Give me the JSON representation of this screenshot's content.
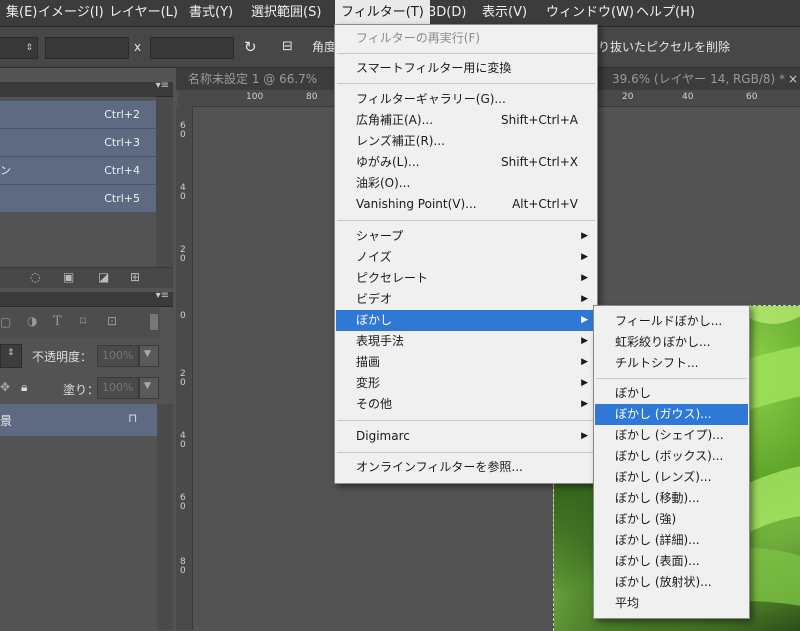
{
  "menubar": {
    "items": [
      "集(E)",
      "イメージ(I)",
      "レイヤー(L)",
      "書式(Y)",
      "選択範囲(S)",
      "フィルター(T)",
      "3D(D)",
      "表示(V)",
      "ウィンドウ(W)",
      "ヘルプ(H)"
    ]
  },
  "options": {
    "x_label": "x",
    "angle_label": "角度",
    "delete_text": "り抜いたピクセルを削除"
  },
  "history": {
    "rows": [
      {
        "label": "",
        "shortcut": "Ctrl+2"
      },
      {
        "label": "",
        "shortcut": "Ctrl+3"
      },
      {
        "label": "ン",
        "shortcut": "Ctrl+4"
      },
      {
        "label": "",
        "shortcut": "Ctrl+5"
      }
    ]
  },
  "layers": {
    "opacity_label": "不透明度：",
    "opacity_value": "100%",
    "fill_label": "塗り：",
    "fill_value": "100%",
    "layer_name": "景"
  },
  "document": {
    "tab_left": "名称未設定 1 @ 66.7%",
    "tab_right": "39.6% (レイヤー 14, RGB/8) *",
    "close": "×",
    "ruler_top": [
      "100",
      "80",
      "20",
      "40",
      "60"
    ],
    "ruler_left": [
      "6\n0",
      "4\n0",
      "2\n0",
      "0",
      "2\n0",
      "4\n0",
      "6\n0",
      "8\n0"
    ]
  },
  "filter_menu": {
    "items": [
      {
        "label": "フィルターの再実行(F)",
        "disabled": true
      },
      {
        "label": "スマートフィルター用に変換"
      },
      {
        "label": "フィルターギャラリー(G)..."
      },
      {
        "label": "広角補正(A)...",
        "shortcut": "Shift+Ctrl+A"
      },
      {
        "label": "レンズ補正(R)..."
      },
      {
        "label": "ゆがみ(L)...",
        "shortcut": "Shift+Ctrl+X"
      },
      {
        "label": "油彩(O)..."
      },
      {
        "label": "Vanishing Point(V)...",
        "shortcut": "Alt+Ctrl+V"
      },
      {
        "label": "シャープ",
        "submenu": true
      },
      {
        "label": "ノイズ",
        "submenu": true
      },
      {
        "label": "ピクセレート",
        "submenu": true
      },
      {
        "label": "ビデオ",
        "submenu": true
      },
      {
        "label": "ぼかし",
        "submenu": true,
        "highlighted": true
      },
      {
        "label": "表現手法",
        "submenu": true
      },
      {
        "label": "描画",
        "submenu": true
      },
      {
        "label": "変形",
        "submenu": true
      },
      {
        "label": "その他",
        "submenu": true
      },
      {
        "label": "Digimarc",
        "submenu": true
      },
      {
        "label": "オンラインフィルターを参照..."
      }
    ]
  },
  "blur_submenu": {
    "items": [
      {
        "label": "フィールドぼかし..."
      },
      {
        "label": "虹彩絞りぼかし..."
      },
      {
        "label": "チルトシフト..."
      },
      {
        "label": "ぼかし"
      },
      {
        "label": "ぼかし (ガウス)...",
        "highlighted": true
      },
      {
        "label": "ぼかし (シェイプ)..."
      },
      {
        "label": "ぼかし (ボックス)..."
      },
      {
        "label": "ぼかし (レンズ)..."
      },
      {
        "label": "ぼかし (移動)..."
      },
      {
        "label": "ぼかし (強)"
      },
      {
        "label": "ぼかし (詳細)..."
      },
      {
        "label": "ぼかし (表面)..."
      },
      {
        "label": "ぼかし (放射状)..."
      },
      {
        "label": "平均"
      }
    ]
  },
  "colors": {
    "menu_highlight": "#2f78d6",
    "history_row": "#5e6a82"
  }
}
